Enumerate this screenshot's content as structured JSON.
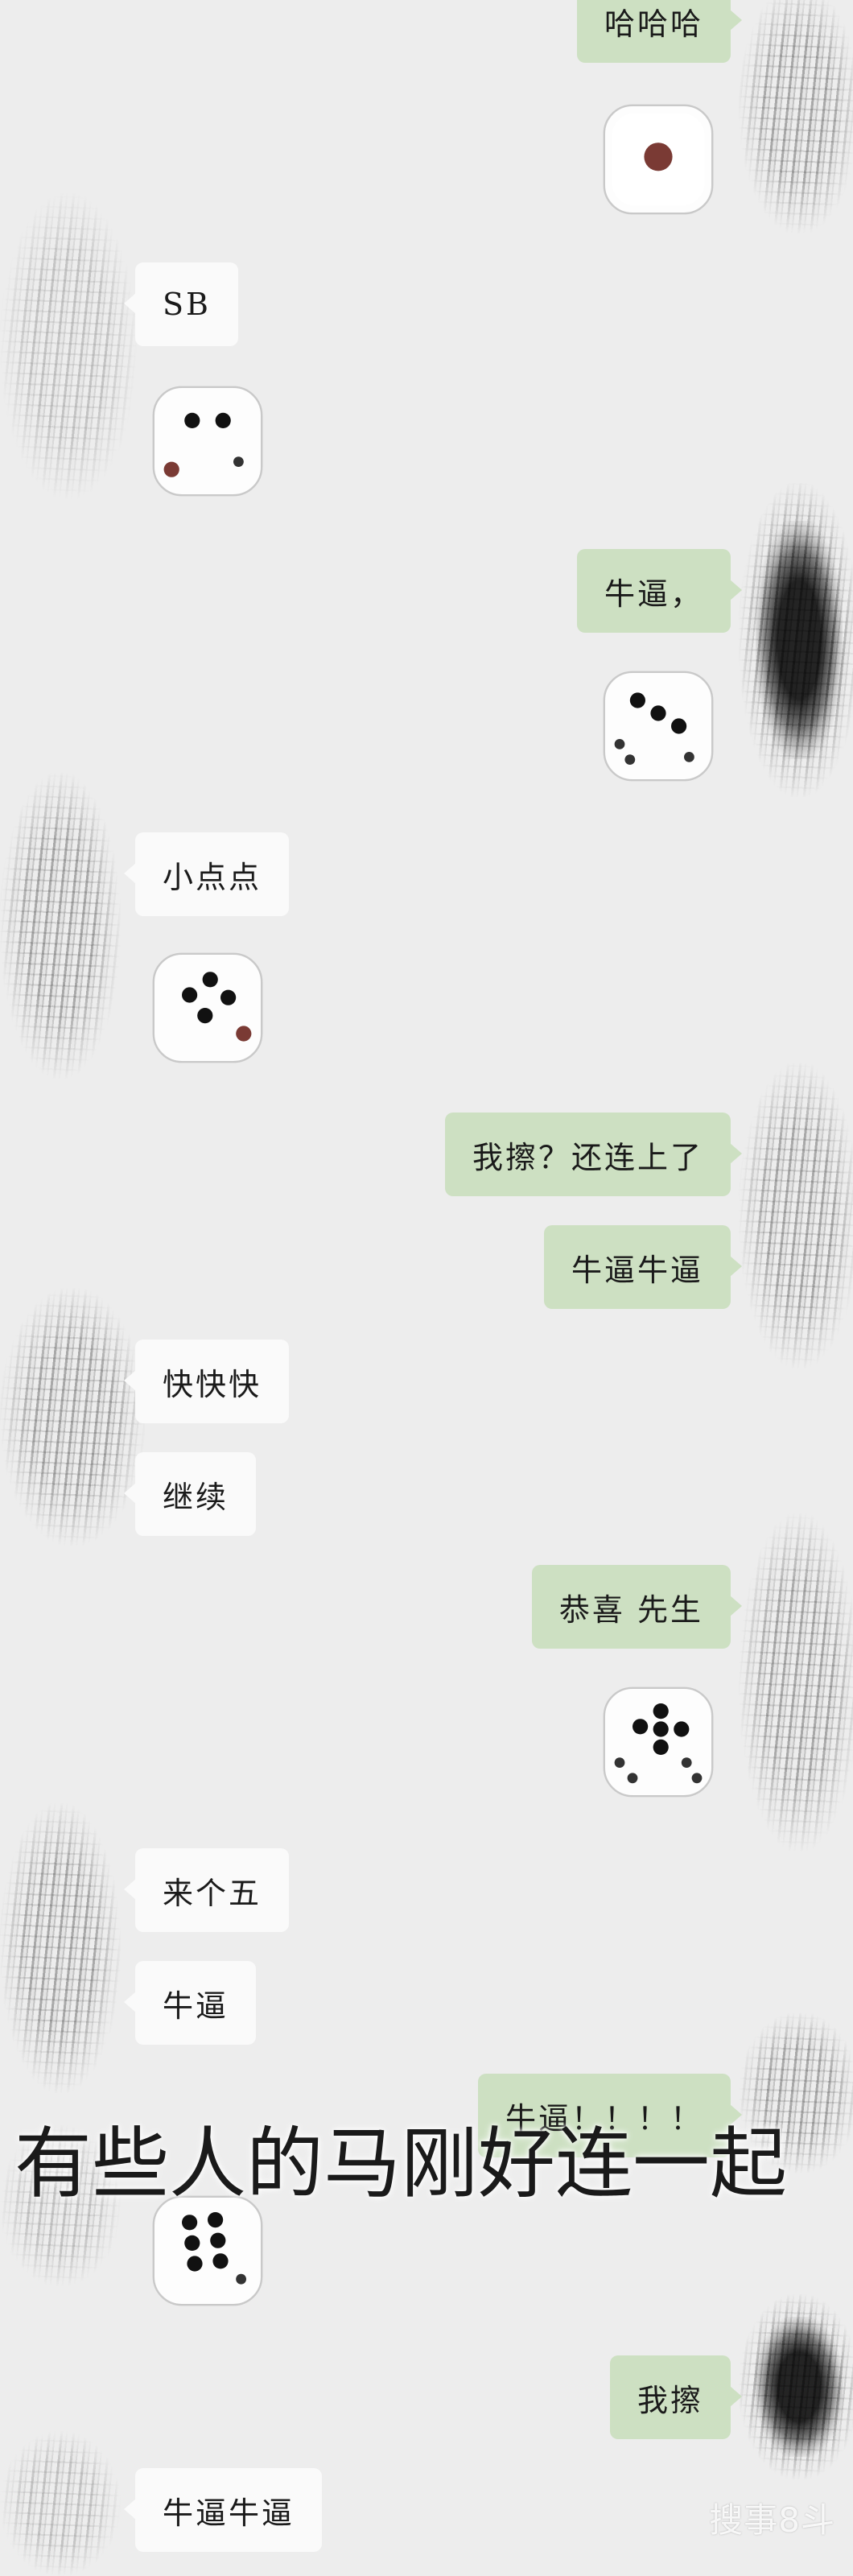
{
  "messages": [
    {
      "side": "right",
      "type": "text",
      "text": "哈哈哈"
    },
    {
      "side": "right",
      "type": "dice",
      "dice_value": 1
    },
    {
      "side": "left",
      "type": "text",
      "text": "SB"
    },
    {
      "side": "left",
      "type": "dice",
      "dice_value": 2
    },
    {
      "side": "right",
      "type": "text",
      "text": "牛逼，"
    },
    {
      "side": "right",
      "type": "dice",
      "dice_value": 3
    },
    {
      "side": "left",
      "type": "text",
      "text": "小点点"
    },
    {
      "side": "left",
      "type": "dice",
      "dice_value": 4
    },
    {
      "side": "right",
      "type": "text",
      "text": "我擦？还连上了"
    },
    {
      "side": "right",
      "type": "text",
      "text": "牛逼牛逼"
    },
    {
      "side": "left",
      "type": "text",
      "text": "快快快"
    },
    {
      "side": "left",
      "type": "text",
      "text": "继续"
    },
    {
      "side": "right",
      "type": "text",
      "text": "恭喜 先生"
    },
    {
      "side": "right",
      "type": "dice",
      "dice_value": 5
    },
    {
      "side": "left",
      "type": "text",
      "text": "来个五"
    },
    {
      "side": "left",
      "type": "text",
      "text": "牛逼"
    },
    {
      "side": "right",
      "type": "text",
      "text": "牛逼！！！！"
    },
    {
      "side": "left",
      "type": "dice",
      "dice_value": 6
    },
    {
      "side": "right",
      "type": "text",
      "text": "我擦"
    },
    {
      "side": "left",
      "type": "text",
      "text": "牛逼牛逼"
    }
  ],
  "overlay_caption": "有些人的马刚好连一起",
  "watermark": "搜事8斗",
  "colors": {
    "background": "#ededed",
    "sent_bubble": "#cde0c2",
    "received_bubble": "#fafafa",
    "pip_red": "#7a3a34"
  }
}
